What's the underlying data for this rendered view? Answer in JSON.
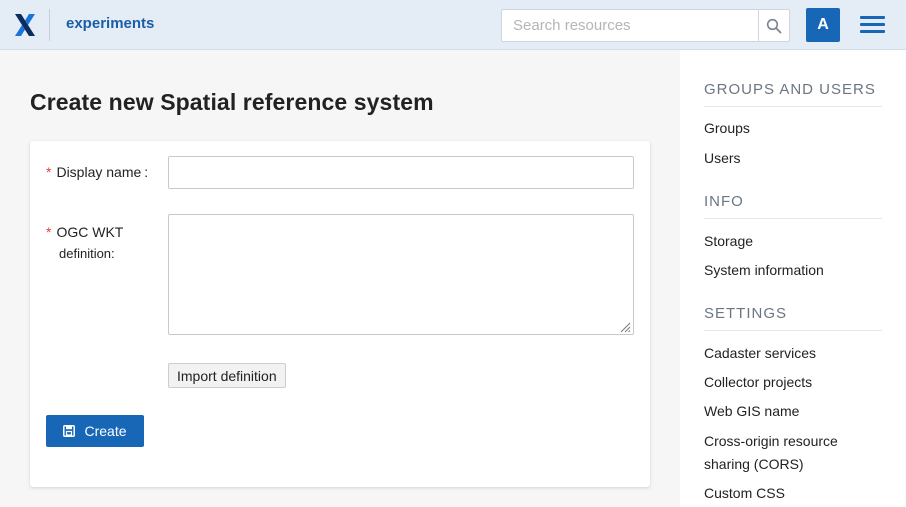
{
  "header": {
    "app_name": "experiments",
    "search_placeholder": "Search resources",
    "avatar_letter": "A",
    "colors": {
      "bar": "#e4ecf6",
      "accent": "#1867b7"
    }
  },
  "page": {
    "title": "Create new Spatial reference system"
  },
  "form": {
    "display_name": {
      "required_mark": "*",
      "label": "Display name",
      "colon": ":",
      "value": ""
    },
    "wkt": {
      "required_mark": "*",
      "label_line1": "OGC WKT",
      "label_line2": "definition:",
      "value": ""
    },
    "import_label": "Import definition",
    "create_label": "Create"
  },
  "sidebar": {
    "groups_users": {
      "title": "GROUPS AND USERS",
      "items": [
        "Groups",
        "Users"
      ]
    },
    "info": {
      "title": "INFO",
      "items": [
        "Storage",
        "System information"
      ]
    },
    "settings": {
      "title": "SETTINGS",
      "items": [
        "Cadaster services",
        "Collector projects",
        "Web GIS name",
        "Cross-origin resource sharing (CORS)",
        "Custom CSS"
      ]
    }
  }
}
